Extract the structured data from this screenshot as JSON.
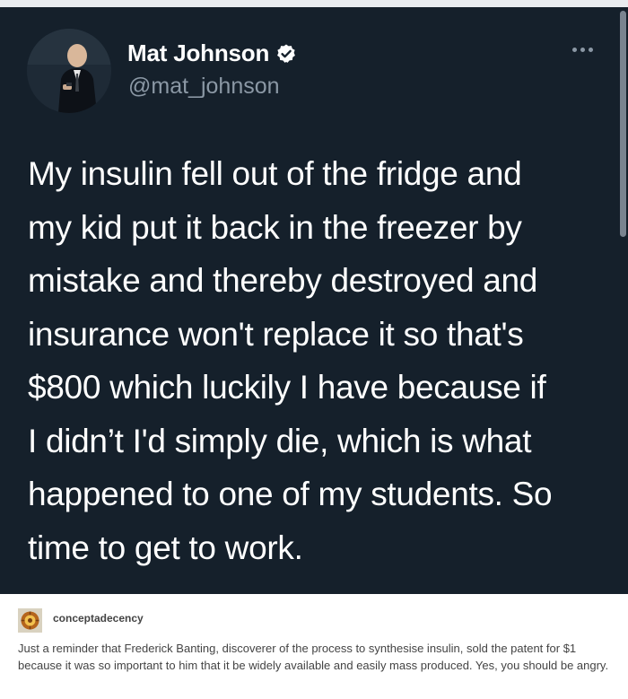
{
  "tweet": {
    "display_name": "Mat Johnson",
    "handle": "@mat_johnson",
    "verified": true,
    "text": "My insulin fell out of the fridge and\nmy kid put it back in the freezer by\nmistake and thereby destroyed and\ninsurance won't replace it so that's\n$800 which luckily I have because if\nI didn’t  I'd simply die, which is what\nhappened to one of my students. So\ntime to get to work.",
    "icons": {
      "verified": "verified-badge-icon",
      "more": "more-options-icon"
    },
    "colors": {
      "background": "#15202b",
      "name": "#ffffff",
      "handle": "#8b98a5",
      "text": "#ffffff"
    }
  },
  "post": {
    "username": "conceptadecency",
    "caption": "Just a reminder that Frederick Banting, discoverer of the process to synthesise insulin, sold the patent for $1 because it was so important to him that it be widely available and easily mass produced. Yes, you should be angry.",
    "colors": {
      "text": "#444444",
      "background": "#ffffff"
    }
  }
}
